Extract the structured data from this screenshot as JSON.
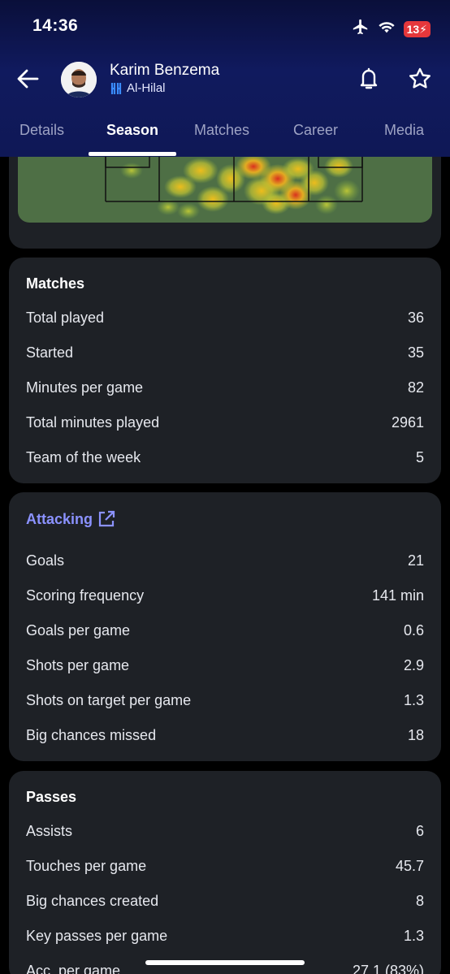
{
  "status": {
    "time": "14:36",
    "battery": "13"
  },
  "player": {
    "name": "Karim Benzema",
    "team": "Al-Hilal"
  },
  "tabs": [
    "Details",
    "Season",
    "Matches",
    "Career",
    "Media"
  ],
  "active_tab": "Season",
  "sections": {
    "matches": {
      "title": "Matches",
      "rows": [
        {
          "label": "Total played",
          "value": "36"
        },
        {
          "label": "Started",
          "value": "35"
        },
        {
          "label": "Minutes per game",
          "value": "82"
        },
        {
          "label": "Total minutes played",
          "value": "2961"
        },
        {
          "label": "Team of the week",
          "value": "5"
        }
      ]
    },
    "attacking": {
      "title": "Attacking",
      "rows": [
        {
          "label": "Goals",
          "value": "21"
        },
        {
          "label": "Scoring frequency",
          "value": "141 min"
        },
        {
          "label": "Goals per game",
          "value": "0.6"
        },
        {
          "label": "Shots per game",
          "value": "2.9"
        },
        {
          "label": "Shots on target per game",
          "value": "1.3"
        },
        {
          "label": "Big chances missed",
          "value": "18"
        }
      ]
    },
    "passes": {
      "title": "Passes",
      "rows": [
        {
          "label": "Assists",
          "value": "6"
        },
        {
          "label": "Touches per game",
          "value": "45.7"
        },
        {
          "label": "Big chances created",
          "value": "8"
        },
        {
          "label": "Key passes per game",
          "value": "1.3"
        },
        {
          "label": "Acc. per game",
          "value": "27.1 (83%)"
        }
      ]
    }
  },
  "colors": {
    "header": "#0f1856",
    "card": "#1e2126",
    "link": "#8b92ff",
    "pitch": "#4e6f45"
  }
}
